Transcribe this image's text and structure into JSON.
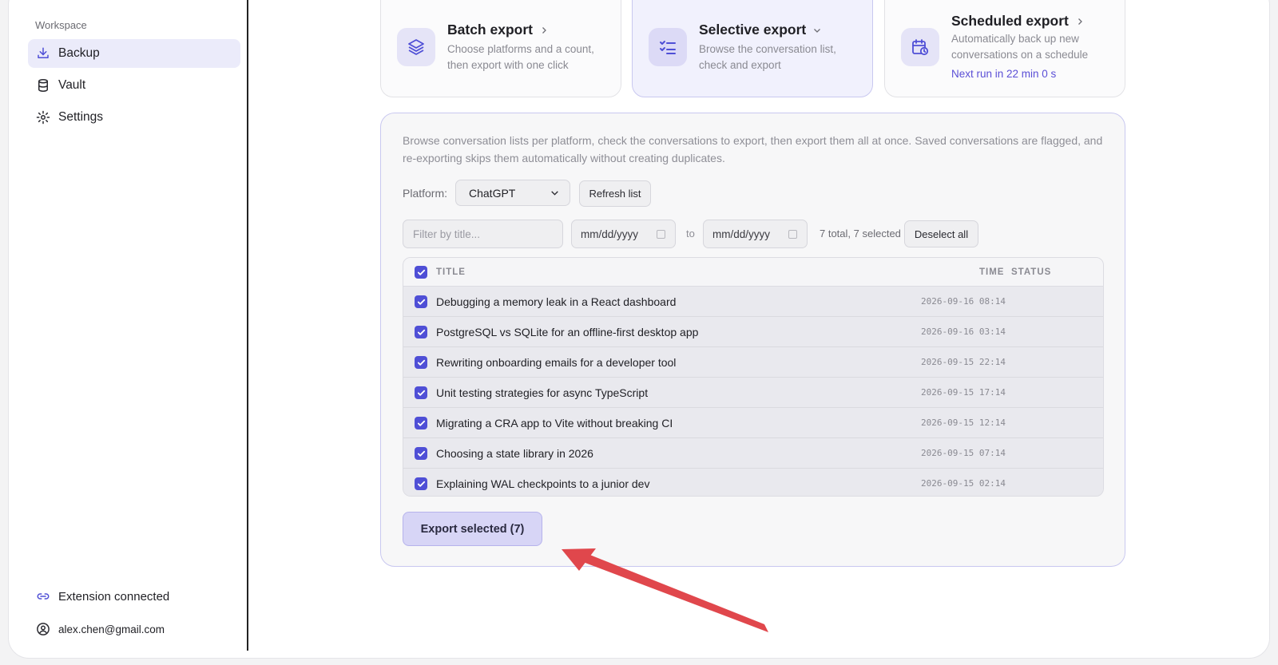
{
  "sidebar": {
    "workspace_label": "Workspace",
    "items": [
      {
        "label": "Backup",
        "icon": "download-tray-icon",
        "active": true
      },
      {
        "label": "Vault",
        "icon": "database-icon",
        "active": false
      },
      {
        "label": "Settings",
        "icon": "gear-icon",
        "active": false
      }
    ],
    "extension_status": "Extension connected",
    "user_email": "alex.chen@gmail.com"
  },
  "cards": {
    "batch": {
      "title": "Batch export",
      "desc": "Choose platforms and a count, then export with one click",
      "icon": "layers-icon"
    },
    "selective": {
      "title": "Selective export",
      "desc": "Browse the conversation list, check and export",
      "icon": "checklist-icon",
      "selected": true
    },
    "scheduled": {
      "title": "Scheduled export",
      "desc": "Automatically back up new conversations on a schedule",
      "next_run": "Next run in 22 min 0 s",
      "icon": "calendar-clock-icon"
    }
  },
  "panel": {
    "description": "Browse conversation lists per platform, check the conversations to export, then export them all at once. Saved conversations are flagged, and re-exporting skips them automatically without creating duplicates.",
    "platform_label": "Platform:",
    "platform_value": "ChatGPT",
    "refresh_label": "Refresh list",
    "filter_placeholder": "Filter by title...",
    "date_from": "mm/dd/yyyy",
    "to_label": "to",
    "date_to": "mm/dd/yyyy",
    "count_text": "7 total, 7 selected",
    "deselect_label": "Deselect all",
    "columns": {
      "title": "TITLE",
      "time": "TIME",
      "status": "STATUS"
    },
    "rows": [
      {
        "title": "Debugging a memory leak in a React dashboard",
        "time": "2026-09-16 08:14",
        "checked": true
      },
      {
        "title": "PostgreSQL vs SQLite for an offline-first desktop app",
        "time": "2026-09-16 03:14",
        "checked": true
      },
      {
        "title": "Rewriting onboarding emails for a developer tool",
        "time": "2026-09-15 22:14",
        "checked": true
      },
      {
        "title": "Unit testing strategies for async TypeScript",
        "time": "2026-09-15 17:14",
        "checked": true
      },
      {
        "title": "Migrating a CRA app to Vite without breaking CI",
        "time": "2026-09-15 12:14",
        "checked": true
      },
      {
        "title": "Choosing a state library in 2026",
        "time": "2026-09-15 07:14",
        "checked": true
      },
      {
        "title": "Explaining WAL checkpoints to a junior dev",
        "time": "2026-09-15 02:14",
        "checked": true
      }
    ],
    "export_label": "Export selected (7)"
  },
  "colors": {
    "accent": "#4f4fd6",
    "link": "#5b4fd6",
    "arrow": "#e0474c"
  }
}
